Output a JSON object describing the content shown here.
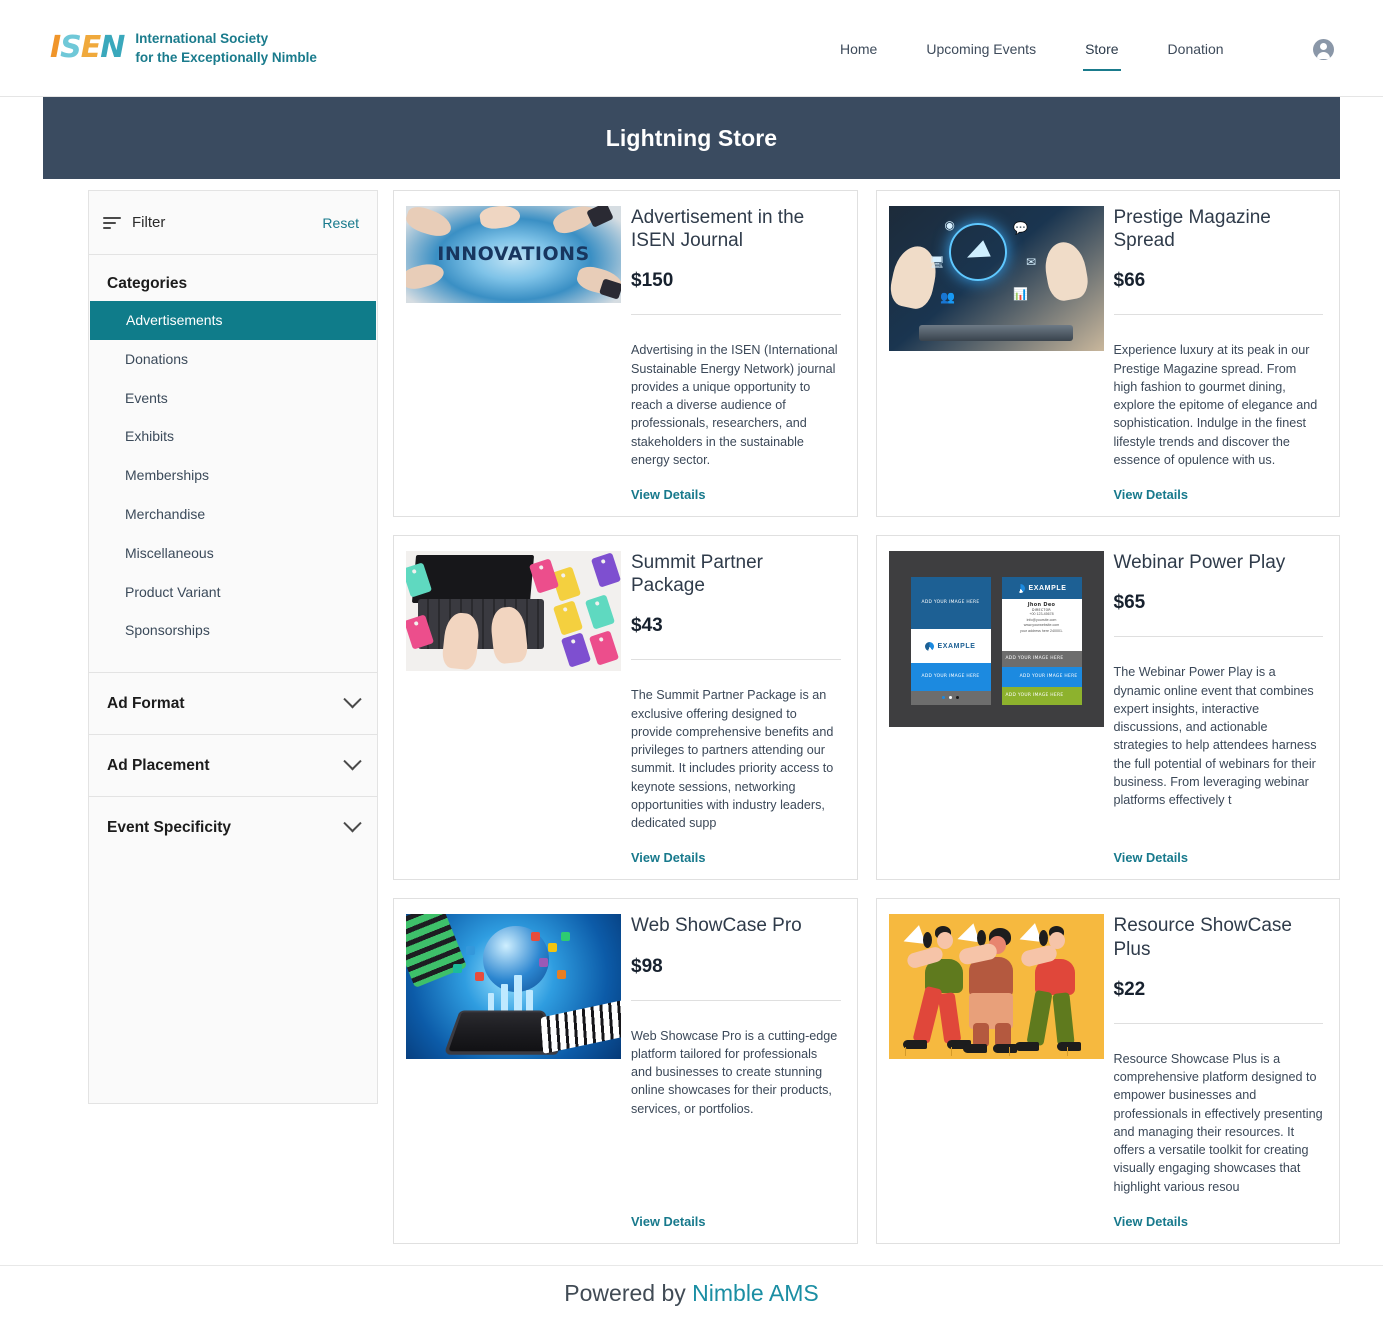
{
  "nav": {
    "logo_mark": [
      "I",
      "S",
      "E",
      "N"
    ],
    "logo_line1": "International Society",
    "logo_line2": "for the Exceptionally Nimble",
    "links": [
      {
        "label": "Home",
        "active": false
      },
      {
        "label": "Upcoming Events",
        "active": false
      },
      {
        "label": "Store",
        "active": true
      },
      {
        "label": "Donation",
        "active": false
      }
    ],
    "avatar_icon": "user-avatar-icon"
  },
  "banner": {
    "title": "Lightning Store"
  },
  "sidebar": {
    "filter_icon": "filter-lines-icon",
    "filter_label": "Filter",
    "reset_label": "Reset",
    "categories_heading": "Categories",
    "categories": [
      {
        "label": "Advertisements",
        "selected": true
      },
      {
        "label": "Donations",
        "selected": false
      },
      {
        "label": "Events",
        "selected": false
      },
      {
        "label": "Exhibits",
        "selected": false
      },
      {
        "label": "Memberships",
        "selected": false
      },
      {
        "label": "Merchandise",
        "selected": false
      },
      {
        "label": "Miscellaneous",
        "selected": false
      },
      {
        "label": "Product Variant",
        "selected": false
      },
      {
        "label": "Sponsorships",
        "selected": false
      }
    ],
    "accordions": [
      {
        "label": "Ad Format",
        "icon": "chevron-down-icon",
        "expanded": false
      },
      {
        "label": "Ad Placement",
        "icon": "chevron-down-icon",
        "expanded": false
      },
      {
        "label": "Event Specificity",
        "icon": "chevron-down-icon",
        "expanded": false
      }
    ]
  },
  "products": [
    {
      "title": "Advertisement in the ISEN Journal",
      "price": "$150",
      "description": "Advertising in the ISEN (International Sustainable Energy Network) journal provides a unique opportunity to reach a diverse audience of professionals, researchers, and stakeholders in the sustainable energy sector.",
      "link_label": "View Details",
      "image_name": "innovations-pointing-hands-image",
      "image_caption": "INNOVATIONS"
    },
    {
      "title": "Prestige Magazine Spread",
      "price": "$66",
      "description": "Experience luxury at its peak in our Prestige Magazine spread. From high fashion to gourmet dining, explore the epitome of elegance and sophistication. Indulge in the finest lifestyle trends and discover the essence of opulence with us.",
      "link_label": "View Details",
      "image_name": "digital-marketing-tablet-image"
    },
    {
      "title": "Summit Partner Package",
      "price": "$43",
      "description": "The Summit Partner Package is an exclusive offering designed to provide comprehensive benefits and privileges to partners attending our summit. It includes priority access to keynote sessions, networking opportunities with industry leaders, dedicated supp",
      "link_label": "View Details",
      "image_name": "laptop-price-tags-image"
    },
    {
      "title": "Webinar Power Play",
      "price": "$65",
      "description": "The Webinar Power Play is a dynamic online event that combines expert insights, interactive discussions, and actionable strategies to help attendees harness the full potential of webinars for their business. From leveraging webinar platforms effectively t",
      "link_label": "View Details",
      "image_name": "brochure-mockup-image",
      "brochure_labels": {
        "image_here": "ADD YOUR IMAGE HERE",
        "brand": "EXAMPLE",
        "person_name": "Jhon Deo",
        "person_role": "DIRECTOR",
        "contact": "+00 123-45678\ninfo@yoursite.com\nwww.yourwebsite.com\nyour address here 240001."
      }
    },
    {
      "title": "Web ShowCase Pro",
      "price": "$98",
      "description": "Web Showcase Pro is a cutting-edge platform tailored for professionals and businesses to create stunning online showcases for their products, services, or portfolios.",
      "link_label": "View Details",
      "image_name": "digital-media-collage-image"
    },
    {
      "title": "Resource ShowCase Plus",
      "price": "$22",
      "description": "Resource Showcase Plus is a comprehensive platform designed to empower businesses and professionals in effectively presenting and managing their resources. It offers a versatile toolkit for creating visually engaging showcases that highlight various resou",
      "link_label": "View Details",
      "image_name": "megaphone-people-illustration-image"
    }
  ],
  "footer": {
    "prefix": "Powered by ",
    "brand": "Nimble AMS"
  },
  "colors": {
    "teal": "#17798c",
    "category_selected": "#0f7c8a",
    "banner_bg": "#3a4b60",
    "logo_orange": "#f0952a",
    "logo_cyan": "#6fc8d8",
    "logo_teal": "#3aa8bc"
  }
}
